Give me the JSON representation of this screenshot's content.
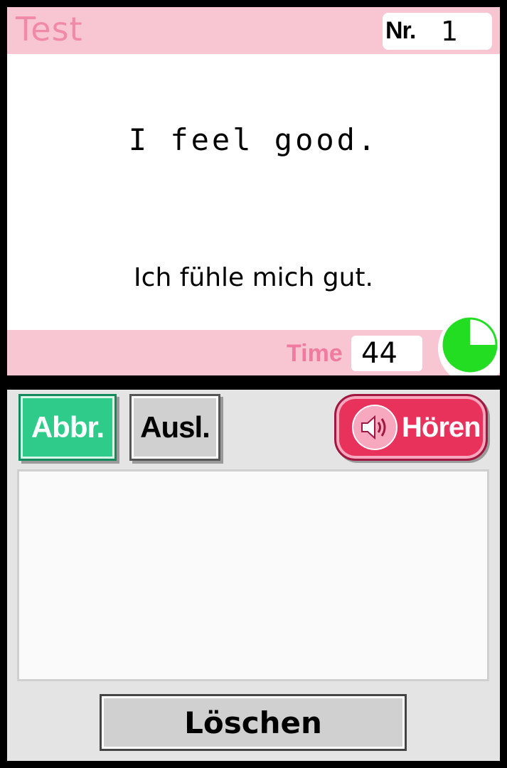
{
  "top_screen": {
    "title": "Test",
    "number_label": "Nr.",
    "number_value": "1",
    "sentence_en": "I feel good.",
    "sentence_de": "Ich fühle mich gut.",
    "time_label": "Time",
    "time_value": "44",
    "timer_fraction_remaining": 0.75
  },
  "bottom_screen": {
    "buttons": {
      "abort": "Abbr.",
      "trigger": "Ausl.",
      "listen": "Hören",
      "clear": "Löschen"
    },
    "listen_icon": "speaker-icon"
  },
  "colors": {
    "header_pink": "#f8c6d2",
    "title_pink": "#f08aa8",
    "abort_green": "#2ecb8a",
    "listen_red": "#e8325c",
    "timer_green": "#22dd22"
  }
}
